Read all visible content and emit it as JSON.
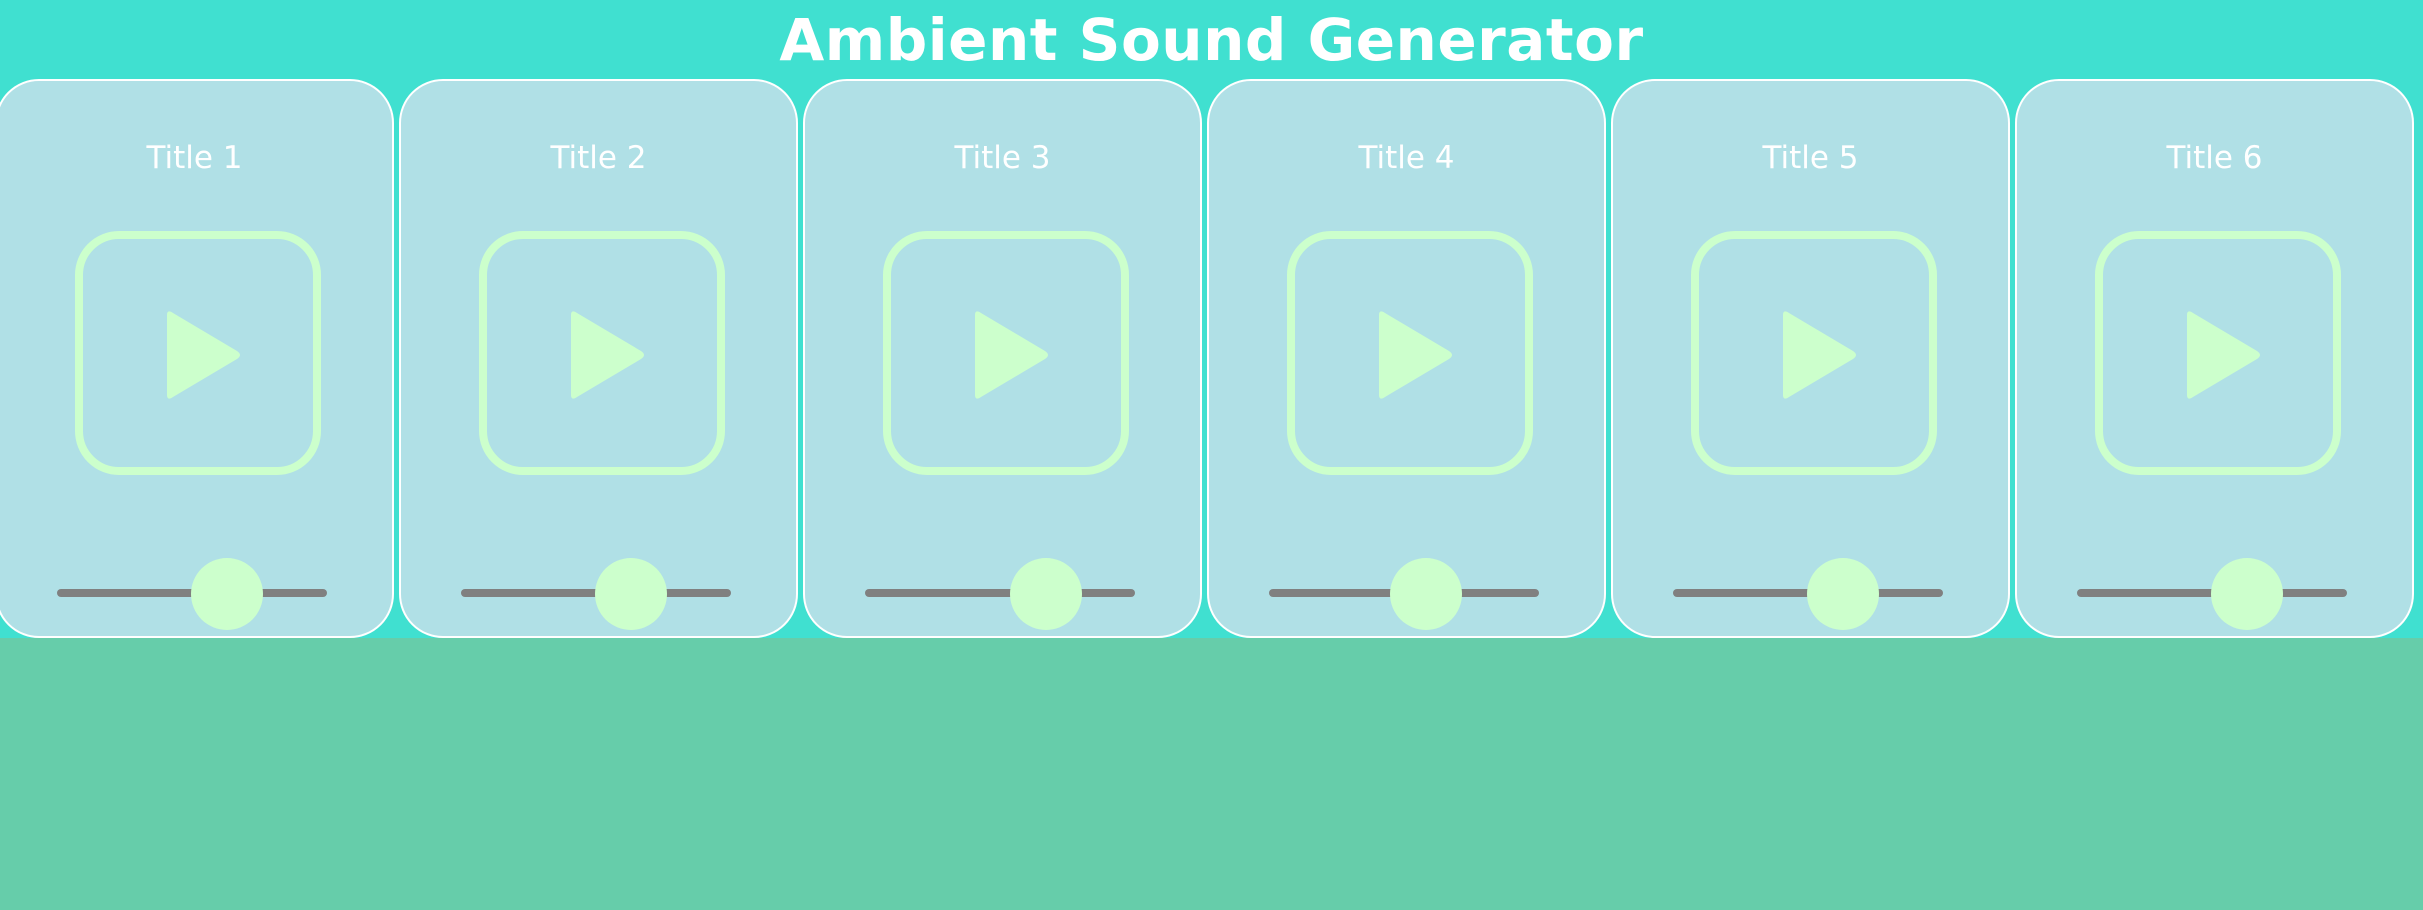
{
  "app": {
    "title": "Ambient Sound Generator"
  },
  "colors": {
    "header_background": "#40e0d0",
    "page_background": "#66cdaa",
    "card_background": "#b0e0e6",
    "accent": "#ccffcc",
    "slider_track": "#808080",
    "text": "#ffffff"
  },
  "cards": [
    {
      "title": "Title 1",
      "play_icon": "play-icon",
      "volume": 0.63
    },
    {
      "title": "Title 2",
      "play_icon": "play-icon",
      "volume": 0.63
    },
    {
      "title": "Title 3",
      "play_icon": "play-icon",
      "volume": 0.67
    },
    {
      "title": "Title 4",
      "play_icon": "play-icon",
      "volume": 0.58
    },
    {
      "title": "Title 5",
      "play_icon": "play-icon",
      "volume": 0.63
    },
    {
      "title": "Title 6",
      "play_icon": "play-icon",
      "volume": 0.63
    }
  ]
}
